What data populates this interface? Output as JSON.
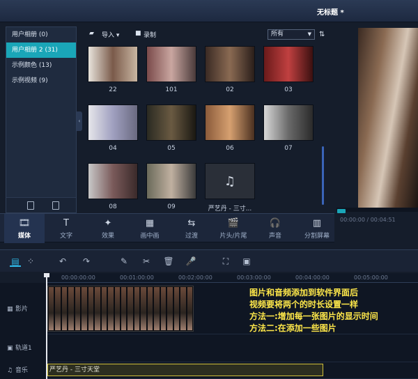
{
  "window": {
    "title": "无标题 *"
  },
  "albums": [
    {
      "label": "用户相册 (0)",
      "active": false
    },
    {
      "label": "用户相册 2 (31)",
      "active": true
    },
    {
      "label": "示例颜色 (13)",
      "active": false
    },
    {
      "label": "示例视频 (9)",
      "active": false
    }
  ],
  "media_toolbar": {
    "import_label": "导入",
    "record_label": "录制",
    "filter_value": "所有"
  },
  "media": [
    {
      "label": "22",
      "colors": [
        "#e8e4dc",
        "#7a5a4a",
        "#c9b6a2"
      ]
    },
    {
      "label": "101",
      "colors": [
        "#7a4a4a",
        "#c9a6a0",
        "#4a3a3a"
      ]
    },
    {
      "label": "02",
      "colors": [
        "#3a2a24",
        "#8a6a52",
        "#2a1e1a"
      ]
    },
    {
      "label": "03",
      "colors": [
        "#6a1a1a",
        "#c04040",
        "#3a1010"
      ]
    },
    {
      "label": "04",
      "colors": [
        "#e6e6ea",
        "#a0a0c0",
        "#6a6a80"
      ]
    },
    {
      "label": "05",
      "colors": [
        "#2a2a22",
        "#6a5a42",
        "#1a1812"
      ]
    },
    {
      "label": "06",
      "colors": [
        "#8a5a3a",
        "#d6a070",
        "#4a3020"
      ]
    },
    {
      "label": "07",
      "colors": [
        "#d8d8d8",
        "#6a6a6a",
        "#2a2a2a"
      ]
    },
    {
      "label": "08",
      "colors": [
        "#c8c8c8",
        "#7a5a5a",
        "#3a2a2a"
      ]
    },
    {
      "label": "09",
      "colors": [
        "#6a6a5a",
        "#c0b0a0",
        "#3a3a3a"
      ]
    },
    {
      "label": "严艺丹 - 三寸...",
      "colors": [
        "#2a2f38",
        "#2a2f38",
        "#2a2f38"
      ]
    }
  ],
  "preview": {
    "timecode": "00:00:00 / 00:04:51"
  },
  "categories": [
    {
      "label": "媒体",
      "icon": "film-icon",
      "active": true
    },
    {
      "label": "文字",
      "icon": "text-icon",
      "active": false
    },
    {
      "label": "效果",
      "icon": "wand-icon",
      "active": false
    },
    {
      "label": "画中画",
      "icon": "pip-icon",
      "active": false
    },
    {
      "label": "过渡",
      "icon": "transition-icon",
      "active": false
    },
    {
      "label": "片头/片尾",
      "icon": "clapper-icon",
      "active": false
    },
    {
      "label": "声音",
      "icon": "headphones-icon",
      "active": false
    },
    {
      "label": "分割屏幕",
      "icon": "split-screen-icon",
      "active": false
    }
  ],
  "ruler": [
    "00:00:00:00",
    "00:01:00:00",
    "00:02:00:00",
    "00:03:00:00",
    "00:04:00:00",
    "00:05:00:00"
  ],
  "tracks": {
    "video": "影片",
    "overlay": "轨道1",
    "music": "音乐"
  },
  "audio_clip": {
    "label": "严艺丹 - 三寸天堂"
  },
  "note": {
    "line1": "图片和音频添加到软件界面后",
    "line2": "视频要将两个的时长设置一样",
    "line3": "方法一:增加每一张图片的显示时间",
    "line4": "方法二:在添加一些图片"
  }
}
